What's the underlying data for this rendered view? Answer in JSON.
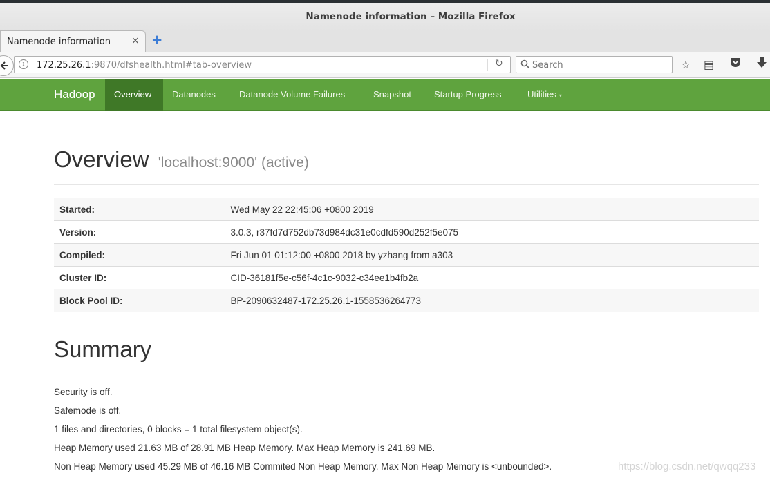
{
  "window": {
    "title": "Namenode information – Mozilla Firefox"
  },
  "tab": {
    "label": "Namenode information",
    "close_glyph": "×",
    "new_glyph": "✚"
  },
  "nav": {
    "url_host": "172.25.26.1",
    "url_rest": ":9870/dfshealth.html#tab-overview",
    "search_placeholder": "Search",
    "icons": [
      "back-icon",
      "site-info-icon",
      "reload-icon",
      "search-icon",
      "bookmark-star-icon",
      "reader-list-icon",
      "pocket-icon",
      "downloads-icon"
    ]
  },
  "hadoop_nav": {
    "brand": "Hadoop",
    "items": [
      "Overview",
      "Datanodes",
      "Datanode Volume Failures",
      "Snapshot",
      "Startup Progress",
      "Utilities"
    ],
    "active": "Overview",
    "accent": "#5fa33e",
    "active_bg": "#3f7827"
  },
  "overview": {
    "title": "Overview",
    "subtitle": "'localhost:9000' (active)",
    "rows": [
      {
        "key": "Started:",
        "value": "Wed May 22 22:45:06 +0800 2019"
      },
      {
        "key": "Version:",
        "value": "3.0.3, r37fd7d752db73d984dc31e0cdfd590d252f5e075"
      },
      {
        "key": "Compiled:",
        "value": "Fri Jun 01 01:12:00 +0800 2018 by yzhang from a303"
      },
      {
        "key": "Cluster ID:",
        "value": "CID-36181f5e-c56f-4c1c-9032-c34ee1b4fb2a"
      },
      {
        "key": "Block Pool ID:",
        "value": "BP-2090632487-172.25.26.1-1558536264773"
      }
    ]
  },
  "summary": {
    "title": "Summary",
    "lines": [
      "Security is off.",
      "Safemode is off.",
      "1 files and directories, 0 blocks = 1 total filesystem object(s).",
      "Heap Memory used 21.63 MB of 28.91 MB Heap Memory. Max Heap Memory is 241.69 MB.",
      "Non Heap Memory used 45.29 MB of 46.16 MB Commited Non Heap Memory. Max Non Heap Memory is <unbounded>."
    ]
  },
  "watermark": "https://blog.csdn.net/qwqq233"
}
